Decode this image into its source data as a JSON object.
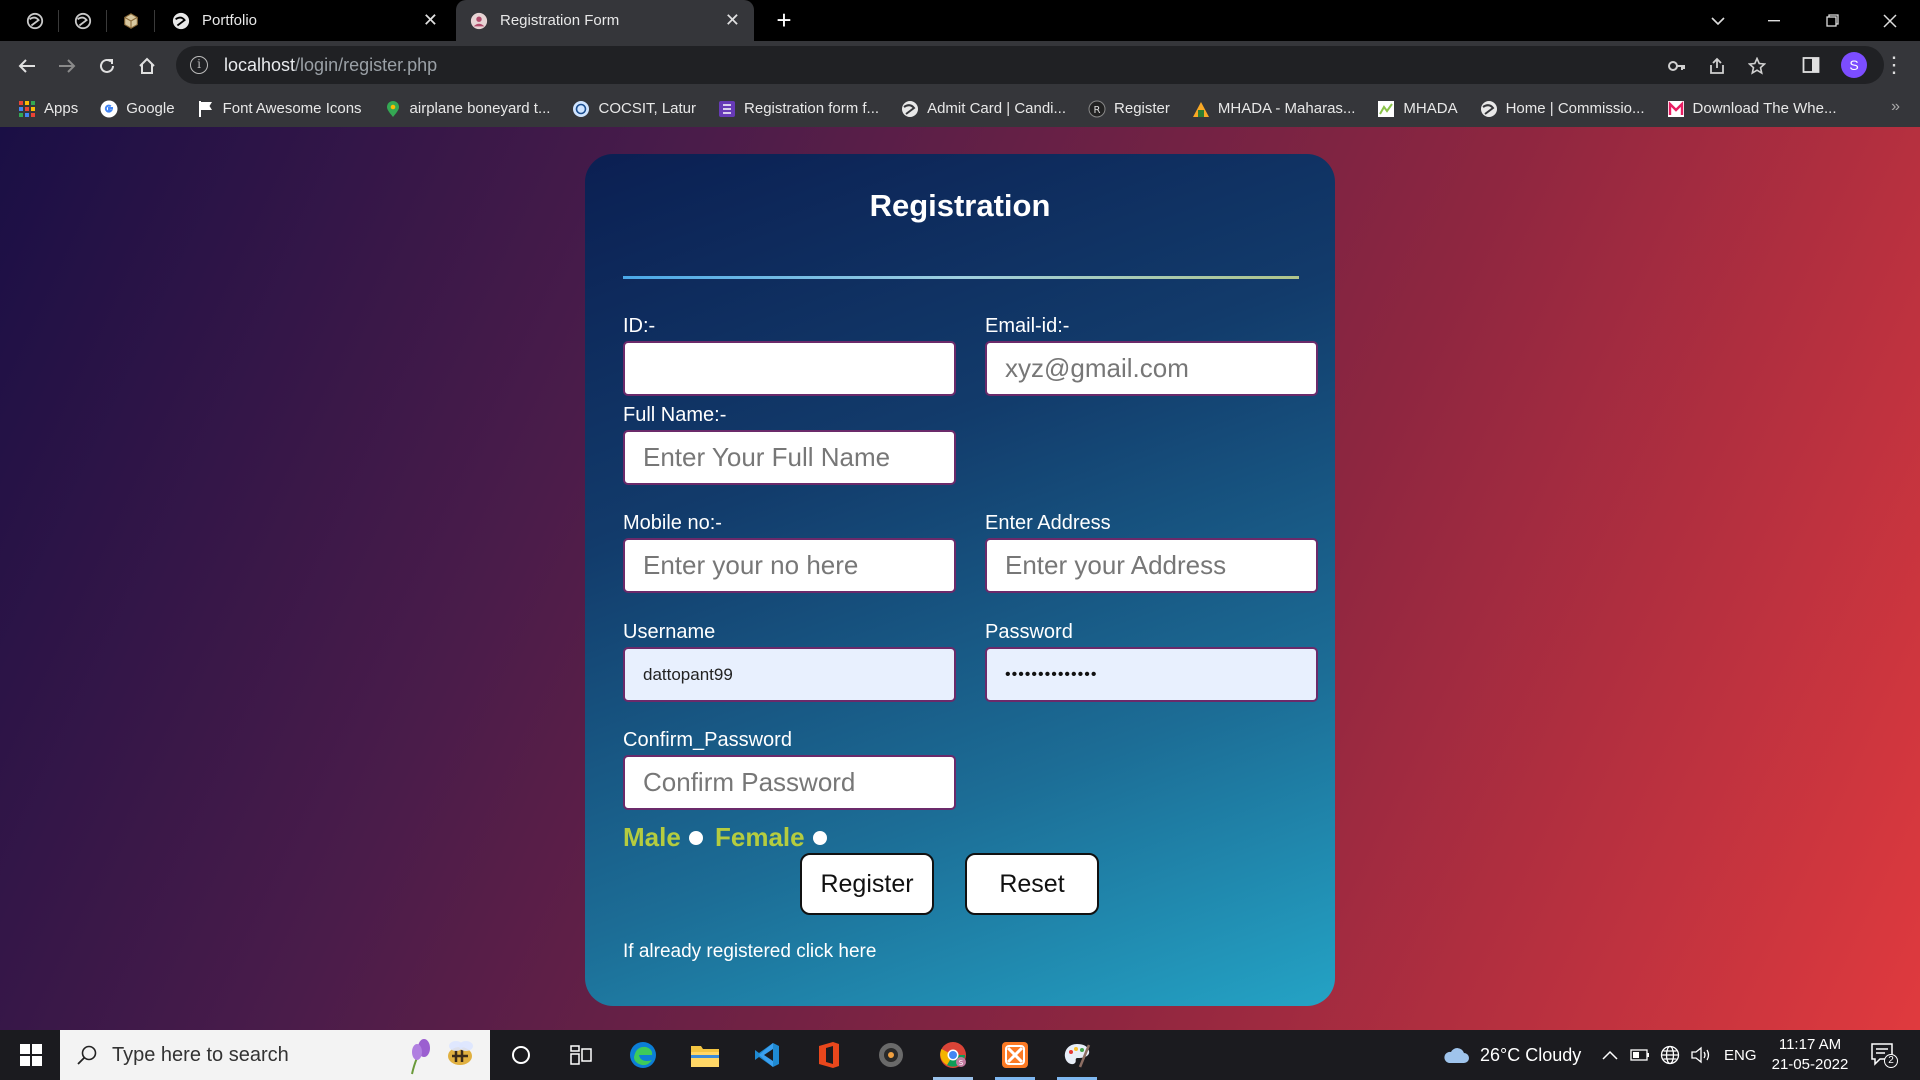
{
  "browser": {
    "tabs": [
      {
        "title": "Portfolio",
        "close": "✕",
        "active": false
      },
      {
        "title": "Registration Form",
        "close": "✕",
        "active": true
      }
    ],
    "new_tab": "+",
    "url_host": "localhost",
    "url_path": "/login/register.php",
    "profile_initial": "S",
    "bookmarks": [
      {
        "label": "Apps",
        "icon": "apps-grid-icon",
        "color": "#4285f4"
      },
      {
        "label": "Google",
        "icon": "google-icon",
        "color": "#ffffff"
      },
      {
        "label": "Font Awesome Icons",
        "icon": "flag-icon",
        "color": "#ffffff"
      },
      {
        "label": "airplane boneyard t...",
        "icon": "map-pin-icon",
        "color": "#34a853"
      },
      {
        "label": "COCSIT, Latur",
        "icon": "cocsit-icon",
        "color": "#d0e4ff"
      },
      {
        "label": "Registration form f...",
        "icon": "forms-icon",
        "color": "#673ab7"
      },
      {
        "label": "Admit Card | Candi...",
        "icon": "globe-icon",
        "color": "#cccccc"
      },
      {
        "label": "Register",
        "icon": "register-icon",
        "color": "#444444"
      },
      {
        "label": "MHADA - Maharas...",
        "icon": "mhada-icon",
        "color": "#2e7d32"
      },
      {
        "label": "MHADA",
        "icon": "mhada-doc-icon",
        "color": "#8bc34a"
      },
      {
        "label": "Home | Commissio...",
        "icon": "globe-icon",
        "color": "#cccccc"
      },
      {
        "label": "Download The Whe...",
        "icon": "m-logo-icon",
        "color": "#e91e63"
      }
    ],
    "more": "»"
  },
  "form": {
    "title": "Registration",
    "id_label": "ID:-",
    "id_value": "",
    "email_label": "Email-id:-",
    "email_placeholder": "xyz@gmail.com",
    "fullname_label": "Full Name:-",
    "fullname_placeholder": "Enter Your Full Name",
    "mobile_label": "Mobile no:-",
    "mobile_placeholder": "Enter your no here",
    "address_label": "Enter Address",
    "address_placeholder": "Enter your Address",
    "username_label": "Username",
    "username_value": "dattopant99",
    "password_label": "Password",
    "password_value": "••••••••••••••",
    "confirm_label": "Confirm_Password",
    "confirm_placeholder": "Confirm Password",
    "male_label": "Male",
    "female_label": "Female",
    "register_button": "Register",
    "reset_button": "Reset",
    "login_link": "If already registered click here"
  },
  "taskbar": {
    "search_placeholder": "Type here to search",
    "weather": "26°C  Cloudy",
    "language": "ENG",
    "time": "11:17 AM",
    "date": "21-05-2022",
    "notification_count": "2"
  },
  "colors": {
    "gender_text": "#b5cc3f",
    "card_top": "#0b1f52",
    "card_bottom": "#24a3c5",
    "bg_left": "#1a0f45",
    "bg_right": "#e03a3e"
  }
}
